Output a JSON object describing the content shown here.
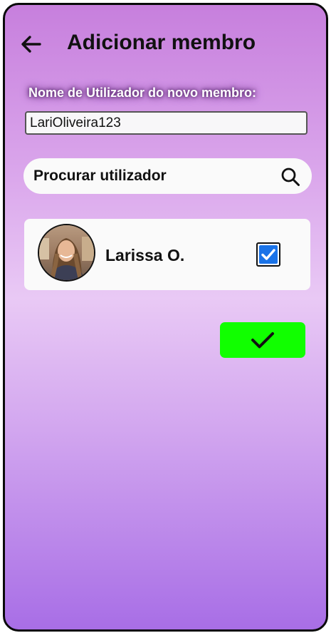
{
  "header": {
    "title": "Adicionar membro",
    "back_icon": "arrow-left-icon"
  },
  "form": {
    "username_label": "Nome de Utilizador do novo membro:",
    "username_value": "LariOliveira123"
  },
  "search": {
    "label": "Procurar utilizador",
    "icon": "search-icon"
  },
  "result": {
    "name": "Larissa O.",
    "selected": true,
    "avatar_icon": "user-photo-avatar"
  },
  "confirm": {
    "icon": "checkmark-icon",
    "color": "#11ff00"
  },
  "colors": {
    "gradient_top": "#c77fdd",
    "gradient_mid": "#e9c9f5",
    "gradient_bottom": "#a86ee6",
    "checkbox_blue": "#1a73e8"
  }
}
